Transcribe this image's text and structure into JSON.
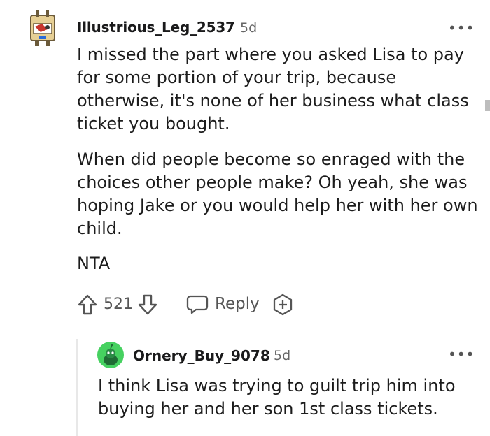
{
  "comment": {
    "username": "Illustrious_Leg_2537",
    "age": "5d",
    "more": "•••",
    "paragraphs": [
      "I missed the part where you asked Lisa to pay for some portion of your trip, because otherwise, it's none of her business what class ticket you bought.",
      "When did people become so enraged with the choices other people make? Oh yeah, she was hoping Jake or you would help her with her own child.",
      "NTA"
    ],
    "score": "521",
    "reply_label": "Reply",
    "icons": [
      "upvote-icon",
      "downvote-icon",
      "reply-icon",
      "award-icon"
    ]
  },
  "reply": {
    "username": "Ornery_Buy_9078",
    "age": "5d",
    "more": "•••",
    "text": "I think Lisa was trying to guilt trip him into buying her and her son 1st class tickets.",
    "avatar_color": "#46d160"
  }
}
